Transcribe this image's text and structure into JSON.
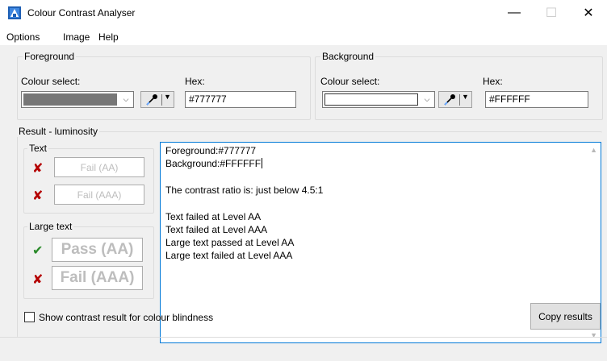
{
  "window": {
    "title": "Colour Contrast Analyser",
    "minimize": "—",
    "maximize": "☐",
    "close": "✕"
  },
  "menu": [
    "Options",
    "Image",
    "Help"
  ],
  "foreground": {
    "group_label": "Foreground",
    "colour_select_label": "Colour select:",
    "hex_label": "Hex:",
    "hex_value": "#777777",
    "swatch_color": "#777777"
  },
  "background": {
    "group_label": "Background",
    "colour_select_label": "Colour select:",
    "hex_label": "Hex:",
    "hex_value": "#FFFFFF",
    "swatch_color": "#FFFFFF"
  },
  "result": {
    "group_label": "Result - luminosity",
    "text_group_label": "Text",
    "text_aa": "Fail (AA)",
    "text_aaa": "Fail (AAA)",
    "large_group_label": "Large text",
    "large_aa": "Pass (AA)",
    "large_aaa": "Fail (AAA)",
    "fail_mark": "✘",
    "pass_mark": "✔",
    "lines": [
      "Foreground:#777777",
      "Background:#FFFFFF",
      "The contrast ratio is: just below 4.5:1",
      "Text failed at Level AA",
      "Text failed at Level AAA",
      "Large text passed at Level AA",
      "Large text failed at Level AAA"
    ]
  },
  "colourblind_label": "Show contrast result for colour blindness",
  "copy_label": "Copy results",
  "colors": {
    "fail": "#b40000",
    "pass": "#2a8a2a",
    "focus_border": "#0078d7"
  }
}
